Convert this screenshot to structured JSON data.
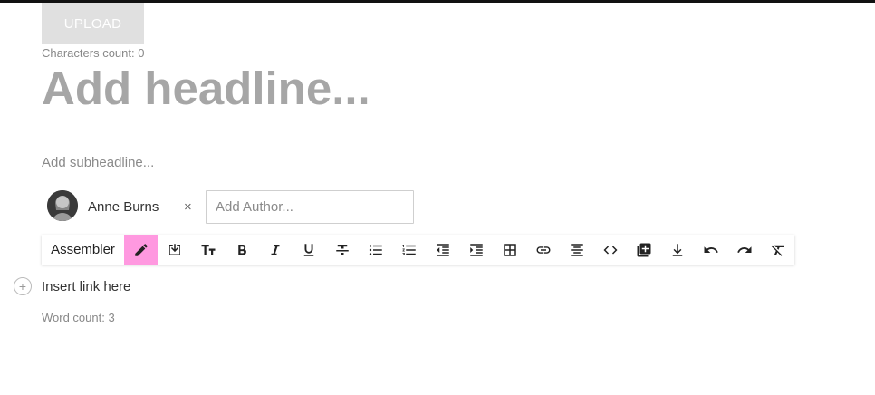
{
  "upload": {
    "label": "UPLOAD"
  },
  "characters_count": "Characters count: 0",
  "headline": {
    "placeholder": "Add headline..."
  },
  "subheadline": {
    "placeholder": "Add subheadline..."
  },
  "author": {
    "name": "Anne Burns",
    "remove_symbol": "×",
    "input_placeholder": "Add Author..."
  },
  "toolbar": {
    "label": "Assembler",
    "active_color": "#ff99e0",
    "buttons": [
      "pencil-icon",
      "insert-box-icon",
      "text-size-icon",
      "bold-icon",
      "italic-icon",
      "underline-icon",
      "strikethrough-icon",
      "bulleted-list-icon",
      "numbered-list-icon",
      "outdent-icon",
      "indent-icon",
      "table-icon",
      "link-icon",
      "align-center-icon",
      "code-icon",
      "add-box-icon",
      "download-icon",
      "undo-icon",
      "redo-icon",
      "clear-format-icon"
    ]
  },
  "editor": {
    "insert_link_text": "Insert link here"
  },
  "word_count": "Word count: 3"
}
